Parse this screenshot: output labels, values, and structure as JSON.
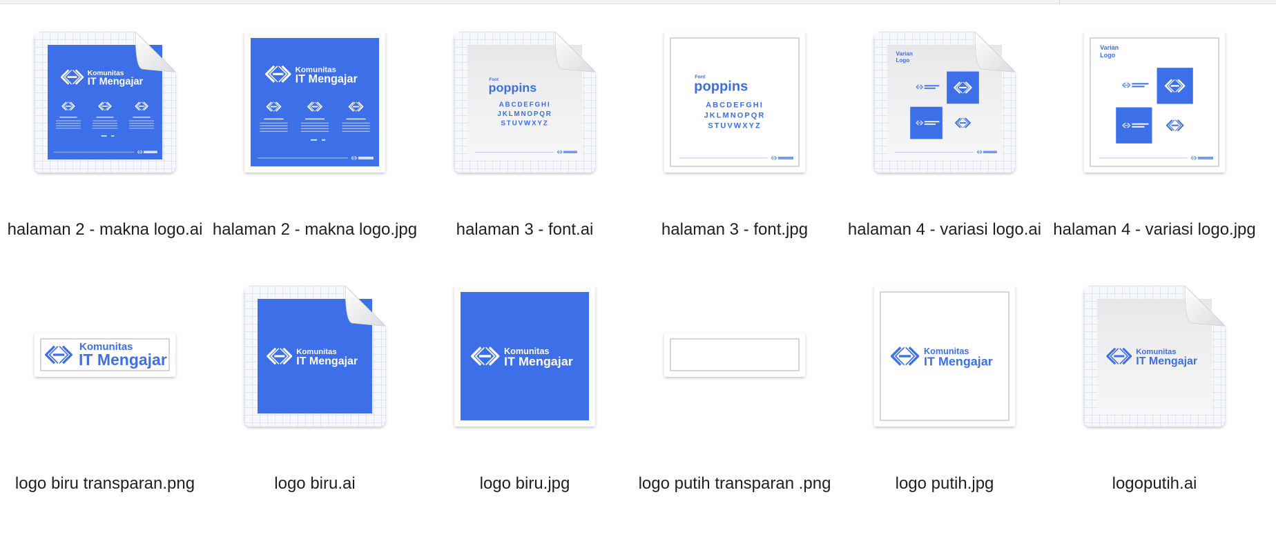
{
  "colors": {
    "brand_blue": "#3d6fe8",
    "paper_gray": "#ececee",
    "grid_line": "#c9d6ea",
    "text": "#1f1f1f"
  },
  "logo_text": {
    "line1": "Komunitas",
    "line2": "IT Mengajar"
  },
  "font_sheet": {
    "label": "Font",
    "name": "poppins",
    "row1": "ABCDEFGHI",
    "row2": "JKLMNOPQR",
    "row3": "STUVWXYZ"
  },
  "variant_sheet": {
    "title_line1": "Varian",
    "title_line2": "Logo"
  },
  "files": [
    {
      "name": "halaman 2 - makna logo.ai",
      "kind": "ai",
      "art": "makna"
    },
    {
      "name": "halaman 2 - makna logo.jpg",
      "kind": "jpg",
      "art": "makna"
    },
    {
      "name": "halaman 3 - font.ai",
      "kind": "ai",
      "art": "font"
    },
    {
      "name": "halaman 3 - font.jpg",
      "kind": "jpg",
      "art": "font"
    },
    {
      "name": "halaman 4 - variasi logo.ai",
      "kind": "ai",
      "art": "variasi"
    },
    {
      "name": "halaman 4 - variasi logo.jpg",
      "kind": "jpg",
      "art": "variasi"
    },
    {
      "name": "logo biru transparan.png",
      "kind": "png-wide",
      "art": "logo-blue-on-white"
    },
    {
      "name": "logo biru.ai",
      "kind": "ai",
      "art": "logo-white-on-blue"
    },
    {
      "name": "logo biru.jpg",
      "kind": "jpg",
      "art": "logo-white-on-blue"
    },
    {
      "name": "logo putih transparan .png",
      "kind": "png-wide",
      "art": "empty"
    },
    {
      "name": "logo putih.jpg",
      "kind": "jpg",
      "art": "logo-blue-on-white"
    },
    {
      "name": "logoputih.ai",
      "kind": "ai",
      "art": "logo-blue-on-gray"
    }
  ]
}
